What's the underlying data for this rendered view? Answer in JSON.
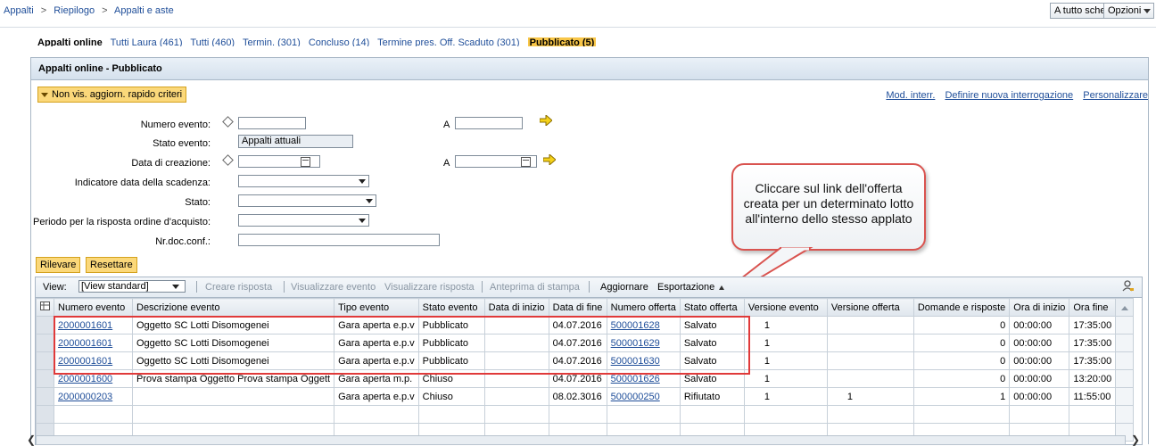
{
  "breadcrumb": {
    "items": [
      "Appalti",
      "Riepilogo",
      "Appalti e aste"
    ],
    "separator": ">"
  },
  "topbar": {
    "fullscreen_label": "A tutto schermo",
    "options_label": "Opzioni"
  },
  "query_links": {
    "title": "Appalti online",
    "items": [
      "Tutti Laura (461)",
      "Tutti (460)",
      "Termin. (301)",
      "Concluso (14)",
      "Termine pres. Off. Scaduto (301)"
    ],
    "active": "Pubblicato (5)"
  },
  "panel": {
    "title": "Appalti online - Pubblicato",
    "toggle_label": "Non vis. aggiorn. rapido criteri",
    "right_links": [
      "Mod. interr.",
      "Definire nuova interrogazione",
      "Personalizzare"
    ]
  },
  "form": {
    "numero_evento_label": "Numero evento:",
    "a_label": "A",
    "stato_evento_label": "Stato evento:",
    "stato_evento_value": "Appalti attuali",
    "data_creazione_label": "Data di creazione:",
    "indicatore_label": "Indicatore data della scadenza:",
    "stato_label": "Stato:",
    "periodo_label": "Periodo per la risposta ordine d'acquisto:",
    "nrdoc_label": "Nr.doc.conf.:",
    "rilevare_label": "Rilevare",
    "resettare_label": "Resettare"
  },
  "callout": {
    "text": "Cliccare sul link dell'offerta creata per un determinato lotto all'interno dello stesso applato"
  },
  "toolbar": {
    "view_label": "View:",
    "view_value": "[View standard]",
    "creare_risposta": "Creare risposta",
    "visualizzare_evento": "Visualizzare evento",
    "visualizzare_risposta": "Visualizzare risposta",
    "anteprima_stampa": "Anteprima di stampa",
    "aggiornare": "Aggiornare",
    "esportazione": "Esportazione"
  },
  "grid": {
    "columns": [
      "Numero evento",
      "Descrizione evento",
      "Tipo evento",
      "Stato evento",
      "Data di inizio",
      "Data di fine",
      "Numero offerta",
      "Stato offerta",
      "Versione evento",
      "Versione offerta",
      "Domande e risposte",
      "Ora di inizio",
      "Ora fine"
    ],
    "rows": [
      [
        "2000001601",
        "Oggetto SC Lotti Disomogenei",
        "Gara aperta e.p.v",
        "Pubblicato",
        "",
        "04.07.2016",
        "500001628",
        "Salvato",
        "1",
        "",
        "0",
        "00:00:00",
        "17:35:00"
      ],
      [
        "2000001601",
        "Oggetto SC Lotti Disomogenei",
        "Gara aperta e.p.v",
        "Pubblicato",
        "",
        "04.07.2016",
        "500001629",
        "Salvato",
        "1",
        "",
        "0",
        "00:00:00",
        "17:35:00"
      ],
      [
        "2000001601",
        "Oggetto SC Lotti Disomogenei",
        "Gara aperta e.p.v",
        "Pubblicato",
        "",
        "04.07.2016",
        "500001630",
        "Salvato",
        "1",
        "",
        "0",
        "00:00:00",
        "17:35:00"
      ],
      [
        "2000001600",
        "Prova stampa Oggetto Prova stampa Oggett",
        "Gara aperta m.p.",
        "Chiuso",
        "",
        "04.07.2016",
        "500001626",
        "Salvato",
        "1",
        "",
        "0",
        "00:00:00",
        "13:20:00"
      ],
      [
        "2000000203",
        "",
        "Gara aperta e.p.v",
        "Chiuso",
        "",
        "08.02.3016",
        "500000250",
        "Rifiutato",
        "1",
        "1",
        "1",
        "00:00:00",
        "11:55:00"
      ]
    ]
  },
  "colors": {
    "link": "#1f4e99",
    "highlight_box": "#e03a3a",
    "button_yellow": "#fbd87a"
  }
}
